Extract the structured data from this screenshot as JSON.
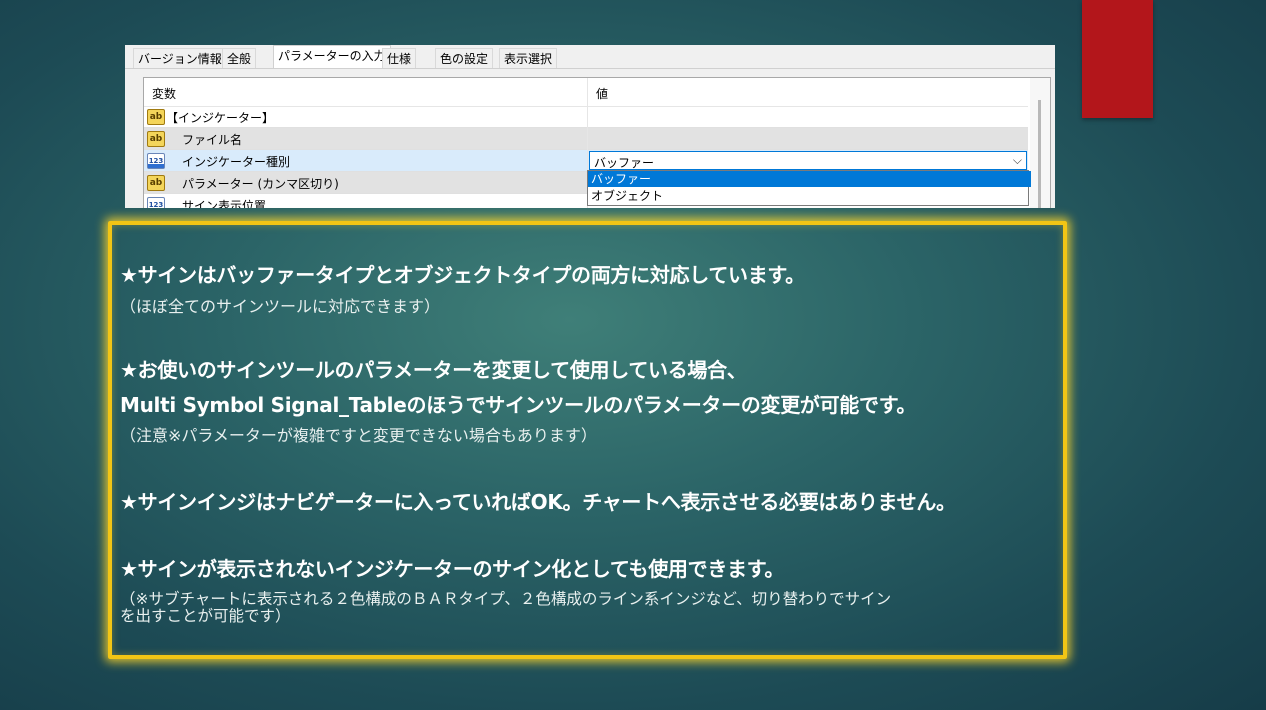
{
  "dialog": {
    "tabs": [
      "バージョン情報",
      "全般",
      "パラメーターの入力",
      "仕様",
      "色の設定",
      "表示選択"
    ],
    "active_tab": "パラメーターの入力",
    "columns": {
      "variable": "変数",
      "value": "値"
    },
    "rows": [
      {
        "type": "ab",
        "label": "【インジケーター】",
        "value": ""
      },
      {
        "type": "ab",
        "label": "ファイル名",
        "value": ""
      },
      {
        "type": "num",
        "label": "インジケーター種別",
        "value": "バッファー"
      },
      {
        "type": "ab",
        "label": "パラメーター (カンマ区切り)",
        "value": ""
      },
      {
        "type": "num",
        "label": "サイン表示位置",
        "value": ""
      }
    ],
    "icons": {
      "ab": "ab",
      "num": "123"
    },
    "dropdown_options": [
      "バッファー",
      "オブジェクト"
    ],
    "dropdown_selected": "バッファー"
  },
  "notes": {
    "n1_title": "★サインはバッファータイプとオブジェクトタイプの両方に対応しています。",
    "n1_sub": "（ほぼ全てのサインツールに対応できます）",
    "n2_title_1": "★お使いのサインツールのパラメーターを変更して使用している場合、",
    "n2_title_2": "Multi Symbol Signal_Tableのほうでサインツールのパラメーターの変更が可能です。",
    "n2_sub": "（注意※パラメーターが複雑ですと変更できない場合もあります）",
    "n3_title": "★サインインジはナビゲーターに入っていればOK。チャートへ表示させる必要はありません。",
    "n4_title": "★サインが表示されないインジケーターのサイン化としても使用できます。",
    "n4_sub_1": "（※サブチャートに表示される２色構成のＢＡＲタイプ、２色構成のライン系インジなど、切り替わりでサイン",
    "n4_sub_2": "を出すことが可能です）"
  },
  "colors": {
    "background": "#2b6467",
    "accent_red": "#b3161b",
    "callout_border": "#f2c515",
    "select_blue": "#0078d7"
  }
}
